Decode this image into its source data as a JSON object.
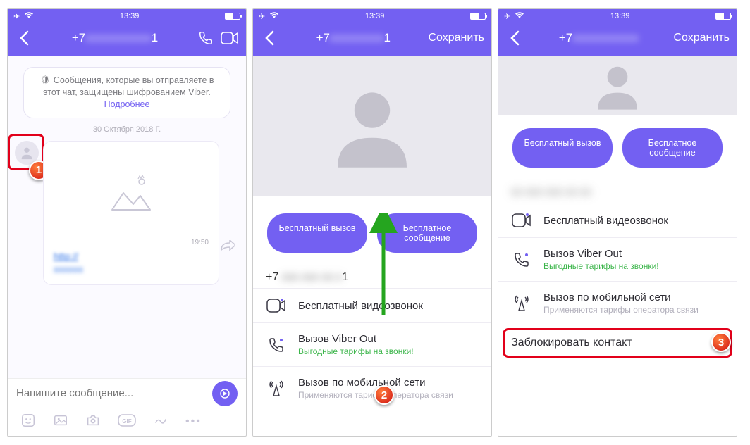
{
  "status": {
    "time": "13:39"
  },
  "screen1": {
    "title_prefix": "+7",
    "title_suffix": "1",
    "encryption_notice": "Сообщения, которые вы отправляете в этот чат, защищены шифрованием Viber.",
    "more": "Подробнее",
    "date": "30 Октября 2018 Г.",
    "msg_time": "19:50",
    "link": "http://",
    "composer_placeholder": "Напишите сообщение..."
  },
  "screen2": {
    "title_prefix": "+7",
    "title_suffix": "1",
    "save": "Сохранить",
    "btn_call": "Бесплатный вызов",
    "btn_msg": "Бесплатное сообщение",
    "phone_prefix": "+7",
    "phone_suffix": "1",
    "item_video": "Бесплатный видеозвонок",
    "item_viberout": "Вызов Viber Out",
    "item_viberout_sub": "Выгодные тарифы на звонки!",
    "item_mobile": "Вызов по мобильной сети",
    "item_mobile_sub": "Применяются тарифы оператора связи"
  },
  "screen3": {
    "title_prefix": "+7",
    "save": "Сохранить",
    "btn_call": "Бесплатный вызов",
    "btn_msg": "Бесплатное сообщение",
    "item_video": "Бесплатный видеозвонок",
    "item_viberout": "Вызов Viber Out",
    "item_viberout_sub": "Выгодные тарифы на звонки!",
    "item_mobile": "Вызов по мобильной сети",
    "item_mobile_sub": "Применяются тарифы оператора связи",
    "block": "Заблокировать контакт"
  },
  "badges": {
    "b1": "1",
    "b2": "2",
    "b3": "3"
  }
}
